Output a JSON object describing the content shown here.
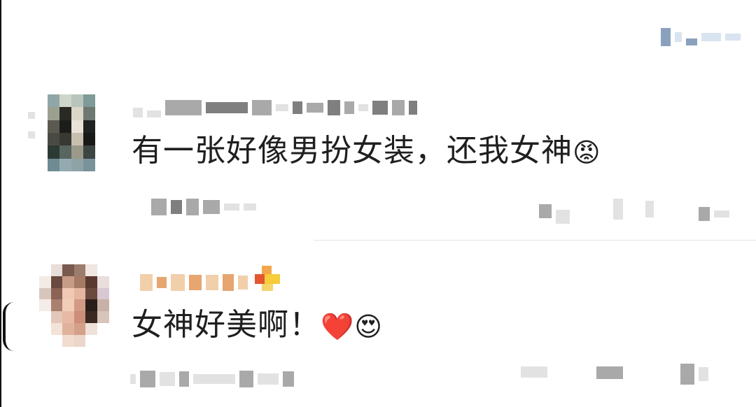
{
  "comments": [
    {
      "text": "有一张好像男扮女装，还我女神",
      "emoji": "😡",
      "emoji_icon": "angry-face-icon"
    },
    {
      "text": "女神好美啊！",
      "emoji_heart": "❤️",
      "emoji_heart_icon": "red-heart-icon",
      "emoji_face": "😍",
      "emoji_face_icon": "heart-eyes-face-icon"
    }
  ],
  "colors": {
    "text": "#1f1f1f",
    "divider": "#e6e6e6",
    "background": "#ffffff"
  }
}
